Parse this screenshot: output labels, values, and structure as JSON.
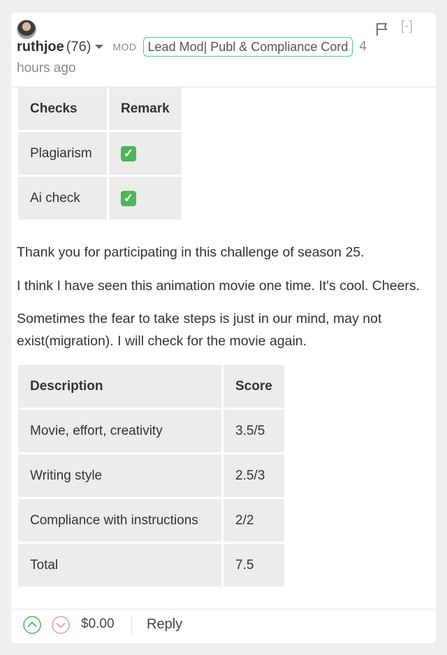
{
  "header": {
    "username": "ruthjoe",
    "reputation": "(76)",
    "role": "MOD",
    "badge": "Lead Mod| Publ & Compliance Cord",
    "time_num": "4",
    "time_rest": "hours ago",
    "collapse": "[-]"
  },
  "checks_table": {
    "headers": [
      "Checks",
      "Remark"
    ],
    "rows": [
      {
        "check": "Plagiarism",
        "remark": "✓"
      },
      {
        "check": "Ai check",
        "remark": "✓"
      }
    ]
  },
  "body": {
    "p1": "Thank you for participating in this challenge of season 25.",
    "p2": "I think I have seen this animation movie one time. It's cool. Cheers.",
    "p3": "Sometimes the fear to take steps is just in our mind, may not exist(migration). I will check for the movie again."
  },
  "score_table": {
    "headers": [
      "Description",
      "Score"
    ],
    "rows": [
      {
        "desc": "Movie, effort, creativity",
        "score": "3.5/5"
      },
      {
        "desc": "Writing style",
        "score": "2.5/3"
      },
      {
        "desc": "Compliance with instructions",
        "score": "2/2"
      },
      {
        "desc": "Total",
        "score": "7.5"
      }
    ]
  },
  "footer": {
    "payout": "$0.00",
    "reply": "Reply"
  },
  "colors": {
    "accent": "#4fc3b0",
    "upvote": "#4fb45c",
    "downvote": "#e8a0a0",
    "check_green": "#4fb45c"
  }
}
